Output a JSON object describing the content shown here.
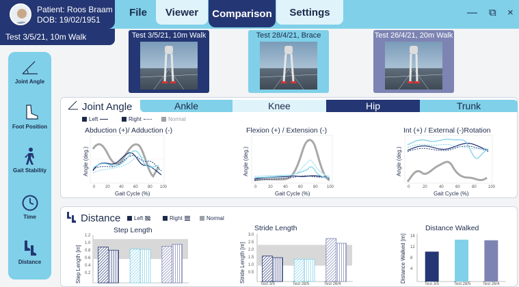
{
  "patient": {
    "name": "Patient: Roos Braam",
    "dob": "DOB: 19/02/1951"
  },
  "menu": {
    "file": "File",
    "viewer": "Viewer",
    "comparison": "Comparison",
    "settings": "Settings"
  },
  "window_controls": {
    "minimize": "—",
    "restore": "⧉",
    "close": "×"
  },
  "current_test": "Test 3/5/21, 10m Walk",
  "tests": [
    {
      "label": "Test 3/5/21, 10m Walk"
    },
    {
      "label": "Test 28/4/21, Brace"
    },
    {
      "label": "Test 26/4/21, 20m Walk"
    }
  ],
  "sidebar": [
    {
      "label": "Joint Angle",
      "icon": "angle-icon"
    },
    {
      "label": "Foot Position",
      "icon": "foot-icon"
    },
    {
      "label": "Gait Stability",
      "icon": "walking-person-icon"
    },
    {
      "label": "Time",
      "icon": "clock-icon"
    },
    {
      "label": "Distance",
      "icon": "footsteps-icon"
    }
  ],
  "joint_angle": {
    "title": "Joint Angle",
    "tabs": [
      "Ankle",
      "Knee",
      "Hip",
      "Trunk"
    ],
    "active_tab": "Hip",
    "legend": {
      "left": "Left",
      "right": "Right",
      "normal": "Normal"
    },
    "charts": [
      {
        "title": "Abduction (+)/ Adduction (-)",
        "ylabel": "Angle (deg.)",
        "xlabel": "Gait Cycle (%)",
        "xticks": [
          "0",
          "20",
          "40",
          "60",
          "80",
          "100"
        ]
      },
      {
        "title": "Flexion (+) / Extension (-)",
        "ylabel": "Angle (deg.)",
        "xlabel": "Gait Cycle (%)",
        "xticks": [
          "0",
          "20",
          "40",
          "60",
          "80",
          "100"
        ]
      },
      {
        "title": "Int (+) / External (-)Rotation",
        "ylabel": "Angle (deg.)",
        "xlabel": "Gait Cycle (%)",
        "xticks": [
          "0",
          "20",
          "40",
          "60",
          "80",
          "100"
        ]
      }
    ]
  },
  "distance": {
    "title": "Distance",
    "legend": {
      "left": "Left",
      "right": "Right",
      "normal": "Normal"
    },
    "charts": [
      {
        "title": "Step Length",
        "ylabel": "Step Length [m]",
        "yticks": [
          "1.2",
          "1.0",
          "0.8",
          "0.6",
          "0.4",
          "0.2"
        ]
      },
      {
        "title": "Stride Length",
        "ylabel": "Stride Length [m]",
        "yticks": [
          "3.0",
          "2.5",
          "2.0",
          "1.5",
          "1.0",
          "0.5"
        ],
        "xticks": [
          "Test 3/5",
          "Test 28/5",
          "Test 26/4"
        ]
      },
      {
        "title": "Distance Walked",
        "ylabel": "Distance Walked [m]",
        "yticks": [
          "16",
          "12",
          "8",
          "4"
        ],
        "xticks": [
          "Test 3/5",
          "Test 28/5",
          "Test 26/4"
        ]
      }
    ]
  },
  "colors": {
    "navy": "#243673",
    "cyan": "#7fd0e8",
    "lavender": "#7d84b3",
    "grey": "#9aa0a6"
  },
  "chart_data": [
    {
      "type": "bar",
      "title": "Step Length",
      "ylabel": "Step Length [m]",
      "ylim": [
        0,
        1.2
      ],
      "normal_band": [
        0.6,
        1.1
      ],
      "categories": [
        "Test 3/5",
        "Test 28/5",
        "Test 26/4"
      ],
      "series": [
        {
          "name": "Left",
          "values": [
            0.9,
            0.85,
            0.92
          ]
        },
        {
          "name": "Right",
          "values": [
            0.82,
            0.84,
            0.97
          ]
        }
      ]
    },
    {
      "type": "bar",
      "title": "Stride Length",
      "ylabel": "Stride Length [m]",
      "ylim": [
        0,
        3.0
      ],
      "normal_band": [
        1.0,
        2.3
      ],
      "categories": [
        "Test 3/5",
        "Test 28/5",
        "Test 26/4"
      ],
      "series": [
        {
          "name": "Left",
          "values": [
            1.6,
            1.4,
            2.7
          ]
        },
        {
          "name": "Right",
          "values": [
            1.5,
            1.4,
            2.4
          ]
        }
      ]
    },
    {
      "type": "bar",
      "title": "Distance Walked",
      "ylabel": "Distance Walked [m]",
      "ylim": [
        0,
        16
      ],
      "categories": [
        "Test 3/5",
        "Test 28/5",
        "Test 26/4"
      ],
      "values": [
        10,
        14,
        13.8
      ]
    }
  ]
}
